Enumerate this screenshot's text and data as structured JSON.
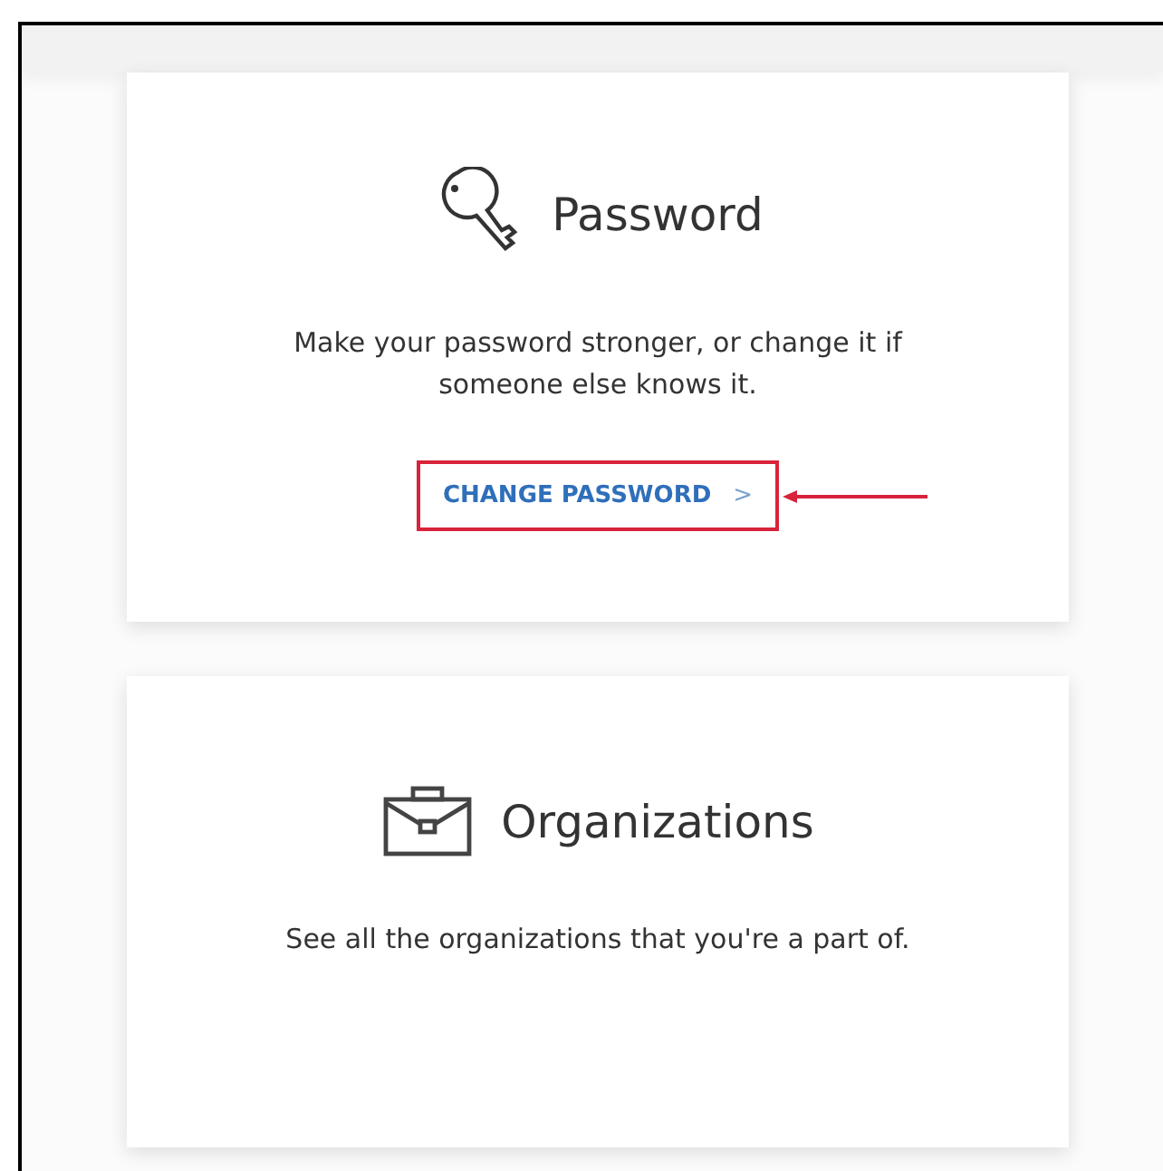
{
  "cards": [
    {
      "kind": "key",
      "title": "Password",
      "description": "Make your password stronger, or change it if someone else knows it.",
      "link": {
        "label": "CHANGE PASSWORD",
        "chevron": ">",
        "annotated": true
      }
    },
    {
      "kind": "briefcase",
      "title": "Organizations",
      "description": "See all the organizations that you're a part of."
    }
  ]
}
